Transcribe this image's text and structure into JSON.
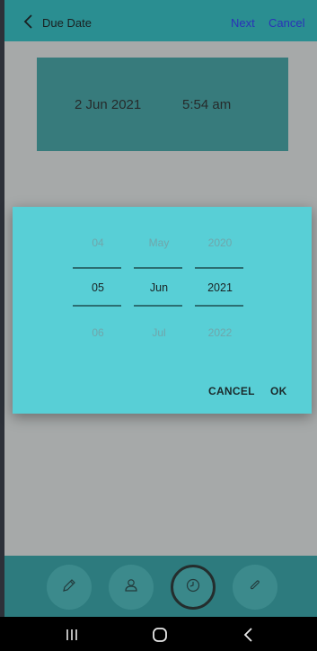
{
  "header": {
    "title": "Due Date",
    "next_label": "Next",
    "cancel_label": "Cancel"
  },
  "card": {
    "date": "2 Jun 2021",
    "time": "5:54 am"
  },
  "picker": {
    "day": {
      "prev": "04",
      "selected": "05",
      "next": "06"
    },
    "month": {
      "prev": "May",
      "selected": "Jun",
      "next": "Jul"
    },
    "year": {
      "prev": "2020",
      "selected": "2021",
      "next": "2022"
    }
  },
  "dialog": {
    "cancel_label": "CANCEL",
    "ok_label": "OK"
  },
  "bottom_actions": [
    {
      "icon": "pencil-icon",
      "active": false
    },
    {
      "icon": "person-icon",
      "active": false
    },
    {
      "icon": "clock-icon",
      "active": true
    },
    {
      "icon": "paperclip-icon",
      "active": false
    }
  ],
  "system_nav": [
    "recents-icon",
    "home-icon",
    "back-icon"
  ],
  "colors": {
    "topbar": "#2a8e91",
    "dialog": "#58cfd6",
    "link": "#2a33b8"
  }
}
